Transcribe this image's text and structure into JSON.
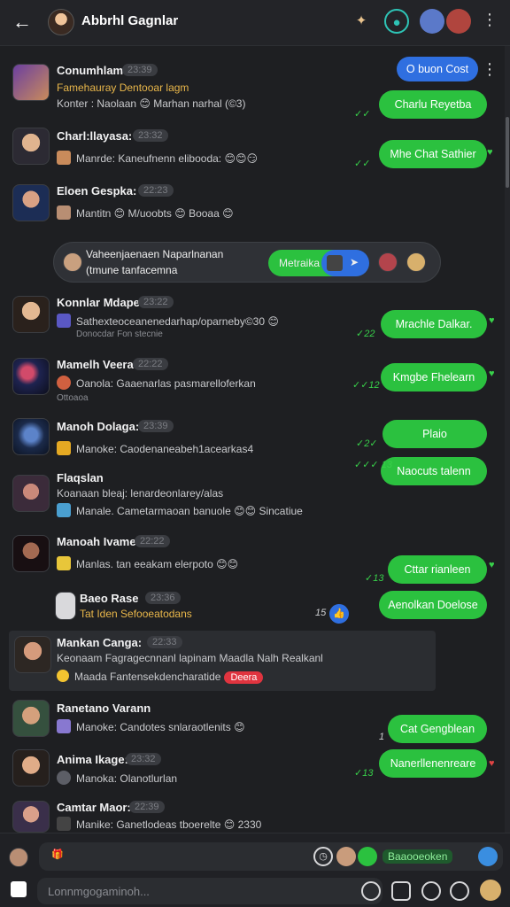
{
  "header": {
    "title": "Abbrhl Gagnlar"
  },
  "messages": [
    {
      "name": "Conumhlam:",
      "time": "23:39",
      "line1": "Famehauray Dentooar lagm",
      "line2": "Konter : Naolaan 😊 Marhan narhal (©3)"
    },
    {
      "name": "Charl:llayasa:",
      "time": "23:32",
      "line1": "Manrde: Kaneufnenn elibooda: 😊😊😏"
    },
    {
      "name": "Eloen Gespka:",
      "time": "22:23",
      "line1": "Mantitn 😊 M/uoobts 😊 Booaa 😊"
    },
    {
      "name": "Konnlar Mdape:",
      "time": "23:22",
      "line1": "Sathexteoceanenedarhap/oparneby©30 😊",
      "line2": "Donocdar Fon stecnie"
    },
    {
      "name": "Mamelh Veera:",
      "time": "22:22",
      "line1": "Oanola: Gaaenarlas pasmarelloferkan",
      "line2": "Ottoaoa"
    },
    {
      "name": "Manoh Dolaga:",
      "time": "23:39",
      "line1": "Manoke: Caodenaneabeh1acearkas4"
    },
    {
      "name": "Flaqslan",
      "line1": "Koanaan bleaj: lenardeonlarey/alas",
      "line2": "Manale. Cametarmaoan banuole 😊😊 Sincatiue"
    },
    {
      "name": "Manoah Ivame:",
      "time": "22:22",
      "line1": "Manlas. tan eeakam elerpoto 😊😊"
    },
    {
      "name": "Baeo Rase",
      "time": "23:36",
      "line1": "Tat Iden Sefooeatodans"
    },
    {
      "name": "Mankan Canga:",
      "time": "22:33",
      "line1": "Keonaam Fagragecnnanl lapinam Maadla Nalh Realkanl",
      "line2": "Maada Fantensekdencharatide",
      "chip": "Deera"
    },
    {
      "name": "Ranetano Varann",
      "line1": "Manoke: Candotes snlaraotlenits 😊"
    },
    {
      "name": "Anima Ikage:",
      "time": "23:32",
      "line1": "Manoka: Olanotlurlan"
    },
    {
      "name": "Camtar Maor:",
      "time": "22:39",
      "line1": "Manike: Ganetlodeas tboerelte 😊 2330"
    }
  ],
  "bubbles": [
    {
      "text": "O buon Cost",
      "tick": ""
    },
    {
      "text": "Charlu Reyetba",
      "tick": "✓✓"
    },
    {
      "text": "Mhe Chat Sathier",
      "tick": "✓✓"
    },
    {
      "text": "Mrachle Dalkar.",
      "tick": "✓22"
    },
    {
      "text": "Kmgbe Fhelearn",
      "tick": "✓✓12"
    },
    {
      "text": "Plaio",
      "tick": "✓2✓"
    },
    {
      "text": "Naocuts talenn",
      "tick": "✓✓✓ 13"
    },
    {
      "text": "Cttar rianleen",
      "tick": "✓13"
    },
    {
      "text": "Aenolkan Doelose",
      "tick": "15"
    },
    {
      "text": "Cat Gengblean",
      "tick": "1"
    },
    {
      "text": "Nanerllenenreare",
      "tick": "✓13"
    }
  ],
  "call_pill": {
    "line1": "Vaheenjaenaen Naparlnanan",
    "line2": "(tmune tanfacemna",
    "action": "Metraika"
  },
  "composer": {
    "attachment_label": "Baaooeoken",
    "placeholder": "Lonnmgogaminoh..."
  },
  "colors": {
    "accent_green": "#2bc13f",
    "accent_blue": "#2f6fe0",
    "background": "#1e1f22"
  }
}
